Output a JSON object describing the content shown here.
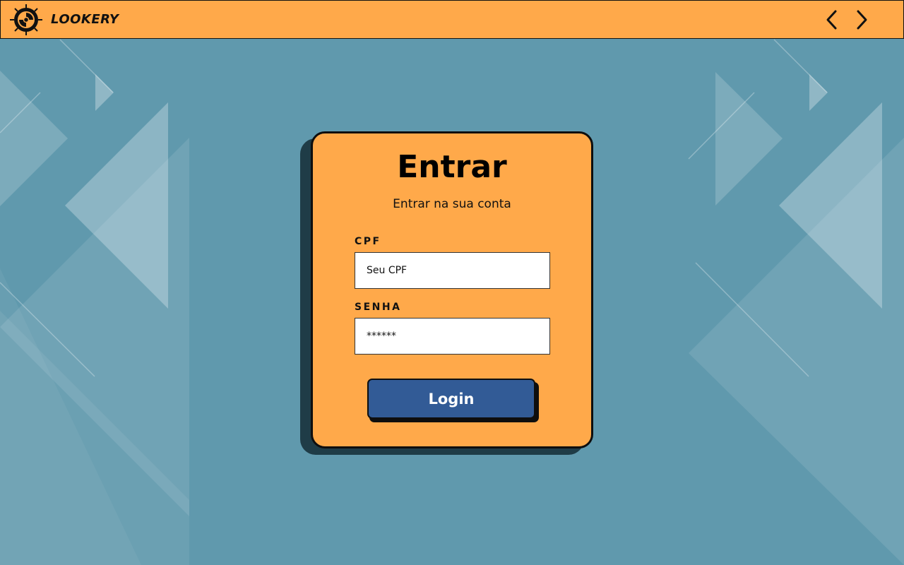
{
  "app": {
    "brand": "LOOKERY"
  },
  "nav": {
    "back_icon": "chevron-left-icon",
    "forward_icon": "chevron-right-icon"
  },
  "login": {
    "title": "Entrar",
    "subtitle": "Entrar na sua conta",
    "cpf_label": "CPF",
    "cpf_placeholder": "Seu CPF",
    "senha_label": "SENHA",
    "senha_placeholder": "******",
    "submit_label": "Login"
  },
  "colors": {
    "background": "#6099ad",
    "accent_orange": "#ffa94a",
    "button_blue": "#325b96",
    "card_shadow": "#1f3c47"
  }
}
